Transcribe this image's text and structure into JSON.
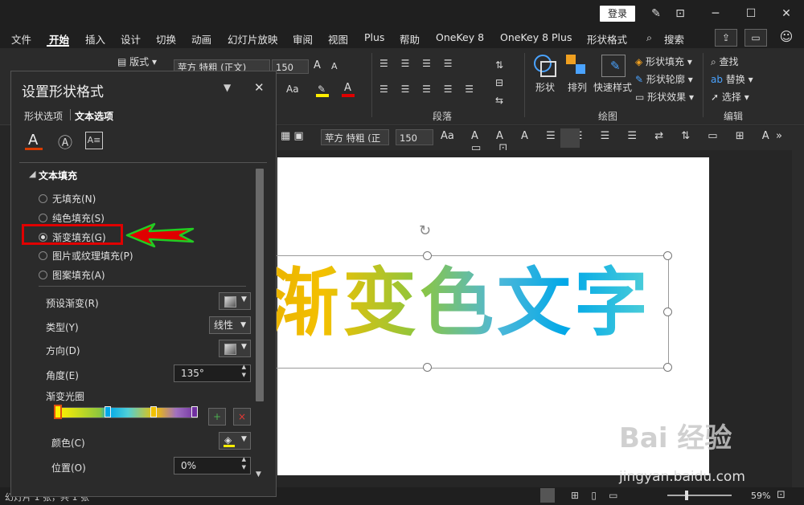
{
  "titlebar": {
    "login": "登录"
  },
  "menu": {
    "items": [
      "文件",
      "开始",
      "插入",
      "设计",
      "切换",
      "动画",
      "幻灯片放映",
      "审阅",
      "视图",
      "Plus",
      "帮助",
      "OneKey 8",
      "OneKey 8 Plus",
      "形状格式",
      "搜索"
    ],
    "active": "开始"
  },
  "ribbon": {
    "layout_label": "版式",
    "font_name": "苹方 特粗 (正文)",
    "font_size": "150",
    "font_grow": "A",
    "font_shrink": "A",
    "case": "Aa",
    "shape_label": "形状",
    "arrange_label": "排列",
    "quick_style_label": "快速样式",
    "shape_fill": "形状填充",
    "shape_outline": "形状轮廓",
    "shape_effect": "形状效果",
    "find": "查找",
    "replace": "替换",
    "select": "选择",
    "group_paragraph": "段落",
    "group_drawing": "绘图",
    "group_editing": "编辑"
  },
  "toolbar2": {
    "font_name": "苹方 特粗 (正",
    "font_size": "150",
    "case": "Aa"
  },
  "slide": {
    "text": "渐变色文字"
  },
  "pane": {
    "title": "设置形状格式",
    "tab_shape": "形状选项",
    "tab_text": "文本选项",
    "section": "文本填充",
    "options": [
      {
        "label": "无填充(N)",
        "checked": false
      },
      {
        "label": "纯色填充(S)",
        "checked": false
      },
      {
        "label": "渐变填充(G)",
        "checked": true
      },
      {
        "label": "图片或纹理填充(P)",
        "checked": false
      },
      {
        "label": "图案填充(A)",
        "checked": false
      }
    ],
    "preset_label": "预设渐变(R)",
    "type_label": "类型(Y)",
    "type_value": "线性",
    "direction_label": "方向(D)",
    "angle_label": "角度(E)",
    "angle_value": "135°",
    "stops_label": "渐变光圈",
    "color_label": "颜色(C)",
    "position_label": "位置(O)",
    "position_value": "0%"
  },
  "statusbar": {
    "left": "幻灯片 1 张，共 1 张",
    "zoom": "59%"
  },
  "watermark": {
    "brand": "Bai 经验",
    "url": "jingyan.baidu.com"
  },
  "colors": {
    "accent_red": "#e00000",
    "arrow_green": "#22cc22",
    "gradient_start": "#f4c000",
    "gradient_end": "#00a8e8"
  }
}
